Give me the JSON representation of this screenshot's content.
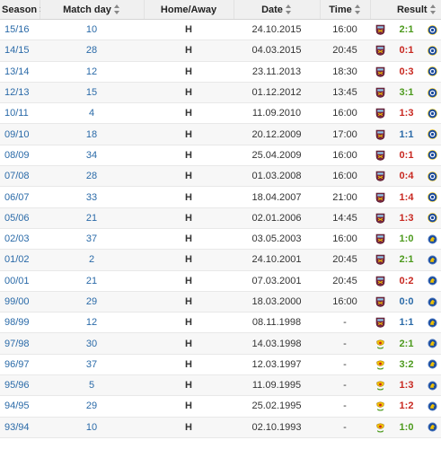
{
  "headers": {
    "season": "Season",
    "matchday": "Match day",
    "homeaway": "Home/Away",
    "date": "Date",
    "time": "Time",
    "result": "Result"
  },
  "colors": {
    "win": "#4c9a1c",
    "loss": "#c8271f",
    "draw": "#2a6aa8",
    "link": "#2a6aa8"
  },
  "rows": [
    {
      "season": "15/16",
      "matchday": "10",
      "ha": "H",
      "date": "24.10.2015",
      "time": "16:00",
      "score": "2:1",
      "outcome": "win",
      "home_crest": "westham-crest-modern-icon",
      "away_crest": "chelsea-crest-modern-icon"
    },
    {
      "season": "14/15",
      "matchday": "28",
      "ha": "H",
      "date": "04.03.2015",
      "time": "20:45",
      "score": "0:1",
      "outcome": "loss",
      "home_crest": "westham-crest-modern-icon",
      "away_crest": "chelsea-crest-modern-icon"
    },
    {
      "season": "13/14",
      "matchday": "12",
      "ha": "H",
      "date": "23.11.2013",
      "time": "18:30",
      "score": "0:3",
      "outcome": "loss",
      "home_crest": "westham-crest-modern-icon",
      "away_crest": "chelsea-crest-modern-icon"
    },
    {
      "season": "12/13",
      "matchday": "15",
      "ha": "H",
      "date": "01.12.2012",
      "time": "13:45",
      "score": "3:1",
      "outcome": "win",
      "home_crest": "westham-crest-modern-icon",
      "away_crest": "chelsea-crest-modern-icon"
    },
    {
      "season": "10/11",
      "matchday": "4",
      "ha": "H",
      "date": "11.09.2010",
      "time": "16:00",
      "score": "1:3",
      "outcome": "loss",
      "home_crest": "westham-crest-modern-icon",
      "away_crest": "chelsea-crest-modern-icon"
    },
    {
      "season": "09/10",
      "matchday": "18",
      "ha": "H",
      "date": "20.12.2009",
      "time": "17:00",
      "score": "1:1",
      "outcome": "draw",
      "home_crest": "westham-crest-modern-icon",
      "away_crest": "chelsea-crest-modern-icon"
    },
    {
      "season": "08/09",
      "matchday": "34",
      "ha": "H",
      "date": "25.04.2009",
      "time": "16:00",
      "score": "0:1",
      "outcome": "loss",
      "home_crest": "westham-crest-modern-icon",
      "away_crest": "chelsea-crest-modern-icon"
    },
    {
      "season": "07/08",
      "matchday": "28",
      "ha": "H",
      "date": "01.03.2008",
      "time": "16:00",
      "score": "0:4",
      "outcome": "loss",
      "home_crest": "westham-crest-modern-icon",
      "away_crest": "chelsea-crest-modern-icon"
    },
    {
      "season": "06/07",
      "matchday": "33",
      "ha": "H",
      "date": "18.04.2007",
      "time": "21:00",
      "score": "1:4",
      "outcome": "loss",
      "home_crest": "westham-crest-modern-icon",
      "away_crest": "chelsea-crest-modern-icon"
    },
    {
      "season": "05/06",
      "matchday": "21",
      "ha": "H",
      "date": "02.01.2006",
      "time": "14:45",
      "score": "1:3",
      "outcome": "loss",
      "home_crest": "westham-crest-modern-icon",
      "away_crest": "chelsea-crest-modern-icon"
    },
    {
      "season": "02/03",
      "matchday": "37",
      "ha": "H",
      "date": "03.05.2003",
      "time": "16:00",
      "score": "1:0",
      "outcome": "win",
      "home_crest": "westham-crest-modern-icon",
      "away_crest": "chelsea-crest-lion-icon"
    },
    {
      "season": "01/02",
      "matchday": "2",
      "ha": "H",
      "date": "24.10.2001",
      "time": "20:45",
      "score": "2:1",
      "outcome": "win",
      "home_crest": "westham-crest-modern-icon",
      "away_crest": "chelsea-crest-lion-icon"
    },
    {
      "season": "00/01",
      "matchday": "21",
      "ha": "H",
      "date": "07.03.2001",
      "time": "20:45",
      "score": "0:2",
      "outcome": "loss",
      "home_crest": "westham-crest-modern-icon",
      "away_crest": "chelsea-crest-lion-icon"
    },
    {
      "season": "99/00",
      "matchday": "29",
      "ha": "H",
      "date": "18.03.2000",
      "time": "16:00",
      "score": "0:0",
      "outcome": "draw",
      "home_crest": "westham-crest-modern-icon",
      "away_crest": "chelsea-crest-lion-icon"
    },
    {
      "season": "98/99",
      "matchday": "12",
      "ha": "H",
      "date": "08.11.1998",
      "time": "-",
      "score": "1:1",
      "outcome": "draw",
      "home_crest": "westham-crest-modern-icon",
      "away_crest": "chelsea-crest-lion-icon"
    },
    {
      "season": "97/98",
      "matchday": "30",
      "ha": "H",
      "date": "14.03.1998",
      "time": "-",
      "score": "2:1",
      "outcome": "win",
      "home_crest": "westham-crest-classic-icon",
      "away_crest": "chelsea-crest-lion-icon"
    },
    {
      "season": "96/97",
      "matchday": "37",
      "ha": "H",
      "date": "12.03.1997",
      "time": "-",
      "score": "3:2",
      "outcome": "win",
      "home_crest": "westham-crest-classic-icon",
      "away_crest": "chelsea-crest-lion-icon"
    },
    {
      "season": "95/96",
      "matchday": "5",
      "ha": "H",
      "date": "11.09.1995",
      "time": "-",
      "score": "1:3",
      "outcome": "loss",
      "home_crest": "westham-crest-classic-icon",
      "away_crest": "chelsea-crest-lion-icon"
    },
    {
      "season": "94/95",
      "matchday": "29",
      "ha": "H",
      "date": "25.02.1995",
      "time": "-",
      "score": "1:2",
      "outcome": "loss",
      "home_crest": "westham-crest-classic-icon",
      "away_crest": "chelsea-crest-lion-icon"
    },
    {
      "season": "93/94",
      "matchday": "10",
      "ha": "H",
      "date": "02.10.1993",
      "time": "-",
      "score": "1:0",
      "outcome": "win",
      "home_crest": "westham-crest-classic-icon",
      "away_crest": "chelsea-crest-lion-icon"
    }
  ]
}
